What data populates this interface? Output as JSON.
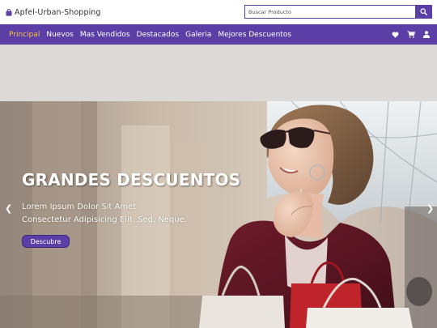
{
  "header": {
    "brand": "Apfel-Urban-Shopping",
    "brand_icon": "shopping-bag-icon",
    "search_placeholder": "Buscar Producto",
    "search_icon": "search-icon"
  },
  "nav": {
    "links": [
      "Principal",
      "Nuevos",
      "Mas Vendidos",
      "Destacados",
      "Galeria",
      "Mejores Descuentos"
    ],
    "active": "Principal",
    "icons": [
      "heart-icon",
      "cart-icon",
      "user-icon"
    ]
  },
  "hero": {
    "title": "GRANDES DESCUENTOS",
    "line1": "Lorem Ipsum Dolor Sit Amet",
    "line2": "Consectetur Adipisicing Elit. Sed, Neque.",
    "button": "Descubre",
    "prev_arrow": "❮",
    "next_arrow": "❯"
  },
  "colors": {
    "primary": "#5b3fa6",
    "active_link": "#f5c542",
    "spacer": "#dcd9d6"
  }
}
